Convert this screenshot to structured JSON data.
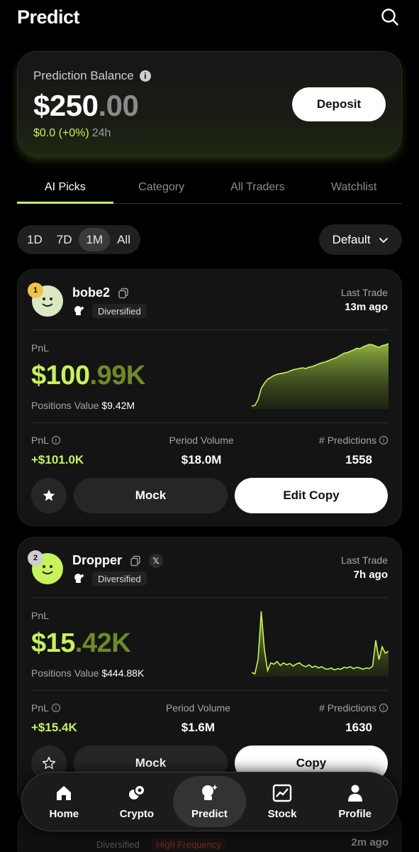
{
  "header": {
    "title": "Predict",
    "search_icon": "search-icon"
  },
  "balance": {
    "label": "Prediction Balance",
    "amount_int": "$250",
    "amount_dec": ".00",
    "change": "$0.0 (+0%)",
    "period": "24h",
    "deposit_label": "Deposit"
  },
  "tabs": [
    {
      "label": "AI Picks",
      "active": true
    },
    {
      "label": "Category",
      "active": false
    },
    {
      "label": "All Traders",
      "active": false
    },
    {
      "label": "Watchlist",
      "active": false
    }
  ],
  "ranges": [
    {
      "label": "1D",
      "active": false
    },
    {
      "label": "7D",
      "active": false
    },
    {
      "label": "1M",
      "active": true
    },
    {
      "label": "All",
      "active": false
    }
  ],
  "sort": {
    "label": "Default"
  },
  "traders": [
    {
      "rank": "1",
      "name": "bobe2",
      "tag": "Diversified",
      "last_trade_label": "Last Trade",
      "last_trade": "13m ago",
      "pnl_label": "PnL",
      "pnl_int": "$100",
      "pnl_dec": ".99K",
      "positions_label": "Positions Value",
      "positions_value": "$9.42M",
      "stat_pnl_label": "PnL",
      "stat_pnl": "+$101.0K",
      "volume_label": "Period Volume",
      "volume": "$18.0M",
      "predictions_label": "# Predictions",
      "predictions": "1558",
      "mock_label": "Mock",
      "copy_label": "Edit Copy",
      "starred": true,
      "sparkline": [
        2,
        3,
        12,
        30,
        38,
        44,
        47,
        50,
        52,
        53,
        54,
        55,
        57,
        59,
        60,
        61,
        62,
        61,
        63,
        64,
        66,
        68,
        70,
        71,
        73,
        75,
        77,
        79,
        82,
        85,
        86,
        88,
        90,
        93,
        92,
        95,
        97,
        99,
        98,
        96,
        94,
        97,
        98,
        100
      ]
    },
    {
      "rank": "2",
      "name": "Dropper",
      "tag": "Diversified",
      "last_trade_label": "Last Trade",
      "last_trade": "7h ago",
      "pnl_label": "PnL",
      "pnl_int": "$15",
      "pnl_dec": ".42K",
      "positions_label": "Positions Value",
      "positions_value": "$444.88K",
      "stat_pnl_label": "PnL",
      "stat_pnl": "+$15.4K",
      "volume_label": "Period Volume",
      "volume": "$1.6M",
      "predictions_label": "# Predictions",
      "predictions": "1630",
      "mock_label": "Mock",
      "copy_label": "Copy",
      "starred": false,
      "sparkline": [
        5,
        3,
        25,
        100,
        40,
        8,
        20,
        18,
        22,
        16,
        20,
        17,
        19,
        15,
        18,
        20,
        16,
        14,
        17,
        13,
        15,
        12,
        14,
        11,
        10,
        12,
        9,
        11,
        10,
        13,
        12,
        14,
        11,
        13,
        12,
        10,
        12,
        11,
        15,
        55,
        25,
        45,
        35,
        38
      ]
    }
  ],
  "peek": {
    "tag": "Diversified",
    "badge": "High Frequency",
    "time": "2m ago"
  },
  "bottom_nav": [
    {
      "label": "Home",
      "icon": "home-icon",
      "active": false
    },
    {
      "label": "Crypto",
      "icon": "crypto-icon",
      "active": false
    },
    {
      "label": "Predict",
      "icon": "predict-icon",
      "active": true
    },
    {
      "label": "Stock",
      "icon": "stock-chart-icon",
      "active": false
    },
    {
      "label": "Profile",
      "icon": "profile-icon",
      "active": false
    }
  ],
  "colors": {
    "accent": "#c7f25c",
    "background": "#000000",
    "card": "#141414"
  }
}
